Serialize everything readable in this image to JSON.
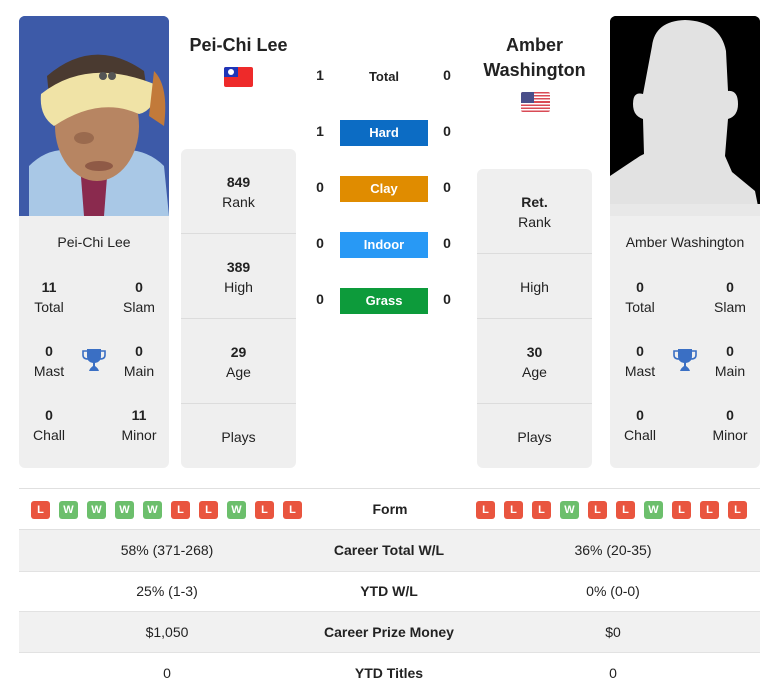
{
  "player_left": {
    "name": "Pei-Chi Lee",
    "card_name": "Pei-Chi Lee",
    "flag": "taiwan-flag",
    "titles": {
      "total": {
        "value": "11",
        "label": "Total"
      },
      "slam": {
        "value": "0",
        "label": "Slam"
      },
      "mast": {
        "value": "0",
        "label": "Mast"
      },
      "main": {
        "value": "0",
        "label": "Main"
      },
      "chall": {
        "value": "0",
        "label": "Chall"
      },
      "minor": {
        "value": "11",
        "label": "Minor"
      }
    },
    "rank": {
      "value": "849",
      "label": "Rank"
    },
    "high": {
      "value": "389",
      "label": "High"
    },
    "age": {
      "value": "29",
      "label": "Age"
    },
    "plays": {
      "value": "",
      "label": "Plays"
    },
    "form": [
      "L",
      "W",
      "W",
      "W",
      "W",
      "L",
      "L",
      "W",
      "L",
      "L"
    ]
  },
  "player_right": {
    "name_line1": "Amber",
    "name_line2": "Washington",
    "card_name": "Amber Washington",
    "flag": "usa-flag",
    "titles": {
      "total": {
        "value": "0",
        "label": "Total"
      },
      "slam": {
        "value": "0",
        "label": "Slam"
      },
      "mast": {
        "value": "0",
        "label": "Mast"
      },
      "main": {
        "value": "0",
        "label": "Main"
      },
      "chall": {
        "value": "0",
        "label": "Chall"
      },
      "minor": {
        "value": "0",
        "label": "Minor"
      }
    },
    "rank": {
      "value": "Ret.",
      "label": "Rank"
    },
    "high": {
      "value": "",
      "label": "High"
    },
    "age": {
      "value": "30",
      "label": "Age"
    },
    "plays": {
      "value": "",
      "label": "Plays"
    },
    "form": [
      "L",
      "L",
      "L",
      "W",
      "L",
      "L",
      "W",
      "L",
      "L",
      "L"
    ]
  },
  "h2h": {
    "total": {
      "label": "Total",
      "left": "1",
      "right": "0"
    },
    "surfaces": [
      {
        "label": "Hard",
        "left": "1",
        "right": "0",
        "color": "#0c6cc4"
      },
      {
        "label": "Clay",
        "left": "0",
        "right": "0",
        "color": "#e08c00"
      },
      {
        "label": "Indoor",
        "left": "0",
        "right": "0",
        "color": "#2899f5"
      },
      {
        "label": "Grass",
        "left": "0",
        "right": "0",
        "color": "#0d9b3b"
      }
    ]
  },
  "comparison": {
    "form_label": "Form",
    "rows": [
      {
        "label": "Career Total W/L",
        "left": "58% (371-268)",
        "right": "36% (20-35)"
      },
      {
        "label": "YTD W/L",
        "left": "25% (1-3)",
        "right": "0% (0-0)"
      },
      {
        "label": "Career Prize Money",
        "left": "$1,050",
        "right": "$0"
      },
      {
        "label": "YTD Titles",
        "left": "0",
        "right": "0"
      }
    ]
  },
  "colors": {
    "loss": "#e9553f",
    "win": "#6cbf6c",
    "trophy": "#3a6fc4",
    "card_bg": "#efefef"
  }
}
